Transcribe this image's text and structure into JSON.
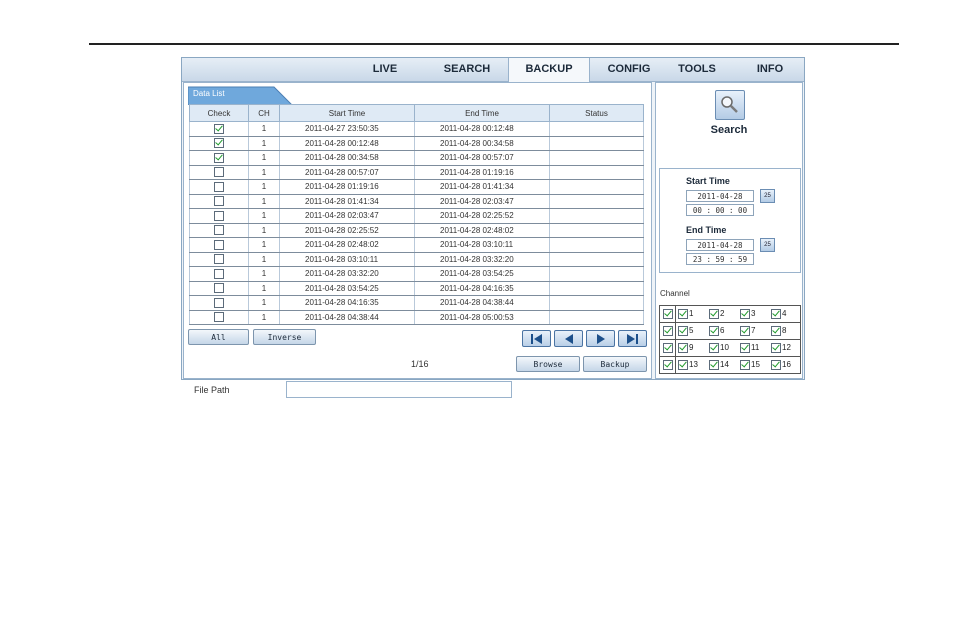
{
  "menu": {
    "items": [
      {
        "label": "LIVE",
        "active": false
      },
      {
        "label": "SEARCH",
        "active": false
      },
      {
        "label": "BACKUP",
        "active": true
      },
      {
        "label": "CONFIG",
        "active": false
      },
      {
        "label": "TOOLS",
        "active": false
      },
      {
        "label": "INFO",
        "active": false
      }
    ]
  },
  "datalist": {
    "tab_label": "Data List",
    "columns": [
      "Check",
      "CH",
      "Start Time",
      "End Time",
      "Status"
    ],
    "rows": [
      {
        "checked": true,
        "ch": "1",
        "start": "2011-04-27 23:50:35",
        "end": "2011-04-28 00:12:48",
        "status": ""
      },
      {
        "checked": true,
        "ch": "1",
        "start": "2011-04-28 00:12:48",
        "end": "2011-04-28 00:34:58",
        "status": ""
      },
      {
        "checked": true,
        "ch": "1",
        "start": "2011-04-28 00:34:58",
        "end": "2011-04-28 00:57:07",
        "status": ""
      },
      {
        "checked": false,
        "ch": "1",
        "start": "2011-04-28 00:57:07",
        "end": "2011-04-28 01:19:16",
        "status": ""
      },
      {
        "checked": false,
        "ch": "1",
        "start": "2011-04-28 01:19:16",
        "end": "2011-04-28 01:41:34",
        "status": ""
      },
      {
        "checked": false,
        "ch": "1",
        "start": "2011-04-28 01:41:34",
        "end": "2011-04-28 02:03:47",
        "status": ""
      },
      {
        "checked": false,
        "ch": "1",
        "start": "2011-04-28 02:03:47",
        "end": "2011-04-28 02:25:52",
        "status": ""
      },
      {
        "checked": false,
        "ch": "1",
        "start": "2011-04-28 02:25:52",
        "end": "2011-04-28 02:48:02",
        "status": ""
      },
      {
        "checked": false,
        "ch": "1",
        "start": "2011-04-28 02:48:02",
        "end": "2011-04-28 03:10:11",
        "status": ""
      },
      {
        "checked": false,
        "ch": "1",
        "start": "2011-04-28 03:10:11",
        "end": "2011-04-28 03:32:20",
        "status": ""
      },
      {
        "checked": false,
        "ch": "1",
        "start": "2011-04-28 03:32:20",
        "end": "2011-04-28 03:54:25",
        "status": ""
      },
      {
        "checked": false,
        "ch": "1",
        "start": "2011-04-28 03:54:25",
        "end": "2011-04-28 04:16:35",
        "status": ""
      },
      {
        "checked": false,
        "ch": "1",
        "start": "2011-04-28 04:16:35",
        "end": "2011-04-28 04:38:44",
        "status": ""
      },
      {
        "checked": false,
        "ch": "1",
        "start": "2011-04-28 04:38:44",
        "end": "2011-04-28 05:00:53",
        "status": ""
      }
    ]
  },
  "controls": {
    "all_label": "All",
    "inverse_label": "Inverse",
    "page_info": "1/16",
    "nav_icons": [
      "first-page-icon",
      "prev-page-icon",
      "next-page-icon",
      "last-page-icon"
    ],
    "file_path_label": "File Path",
    "file_path_value": "",
    "browse_label": "Browse",
    "backup_label": "Backup"
  },
  "search_panel": {
    "search_label": "Search",
    "start_time_label": "Start Time",
    "start_date": "2011-04-28",
    "start_clock": "00 : 00 : 00",
    "end_time_label": "End Time",
    "end_date": "2011-04-28",
    "end_clock": "23 : 59 : 59",
    "calendar_icon_text": "25",
    "channel_label": "Channel",
    "channel_rows": [
      {
        "all_checked": true,
        "channels": [
          {
            "n": "1",
            "checked": true
          },
          {
            "n": "2",
            "checked": true
          },
          {
            "n": "3",
            "checked": true
          },
          {
            "n": "4",
            "checked": true
          }
        ]
      },
      {
        "all_checked": true,
        "channels": [
          {
            "n": "5",
            "checked": true
          },
          {
            "n": "6",
            "checked": true
          },
          {
            "n": "7",
            "checked": true
          },
          {
            "n": "8",
            "checked": true
          }
        ]
      },
      {
        "all_checked": true,
        "channels": [
          {
            "n": "9",
            "checked": true
          },
          {
            "n": "10",
            "checked": true
          },
          {
            "n": "11",
            "checked": true
          },
          {
            "n": "12",
            "checked": true
          }
        ]
      },
      {
        "all_checked": true,
        "channels": [
          {
            "n": "13",
            "checked": true
          },
          {
            "n": "14",
            "checked": true
          },
          {
            "n": "15",
            "checked": true
          },
          {
            "n": "16",
            "checked": true
          }
        ]
      }
    ]
  },
  "colors": {
    "accent": "#6fa8dc",
    "panel_border": "#9ab3cc",
    "check_green": "#1e9a2c"
  }
}
